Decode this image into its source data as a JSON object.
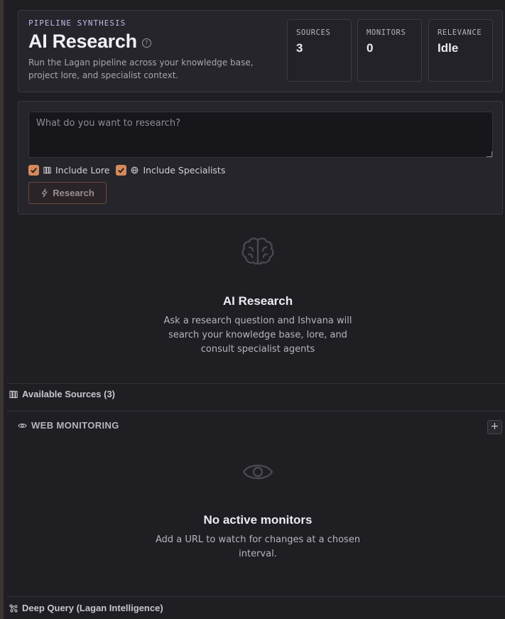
{
  "header": {
    "eyebrow": "PIPELINE SYNTHESIS",
    "title": "AI Research",
    "help_icon": "help-circle-icon",
    "subtitle": "Run the Lagan pipeline across your knowledge base, project lore, and specialist context.",
    "stats": [
      {
        "label": "SOURCES",
        "value": "3"
      },
      {
        "label": "MONITORS",
        "value": "0"
      },
      {
        "label": "RELEVANCE",
        "value": "Idle"
      }
    ]
  },
  "query": {
    "placeholder": "What do you want to research?",
    "include_lore": {
      "label": "Include Lore",
      "checked": true,
      "icon": "books-icon"
    },
    "include_specialists": {
      "label": "Include Specialists",
      "checked": true,
      "icon": "globe-icon"
    },
    "research_button": {
      "label": "Research",
      "icon": "lightning-icon"
    }
  },
  "research_empty": {
    "icon": "brain-icon",
    "title": "AI Research",
    "text": "Ask a research question and Ishvana will search your knowledge base, lore, and consult specialist agents"
  },
  "available_sources": {
    "label": "Available Sources (3)",
    "icon": "books-icon"
  },
  "web_monitoring": {
    "label": "WEB MONITORING",
    "icon": "eye-icon",
    "add_button": "+",
    "empty_icon": "eye-icon",
    "empty_title": "No active monitors",
    "empty_text": "Add a URL to watch for changes at a chosen interval."
  },
  "deep_query": {
    "label": "Deep Query (Lagan Intelligence)",
    "icon": "network-icon"
  },
  "colors": {
    "background": "#1f1e23",
    "card": "#26252b",
    "accent": "#d6895a",
    "eyebrow": "#c4b5e6"
  }
}
